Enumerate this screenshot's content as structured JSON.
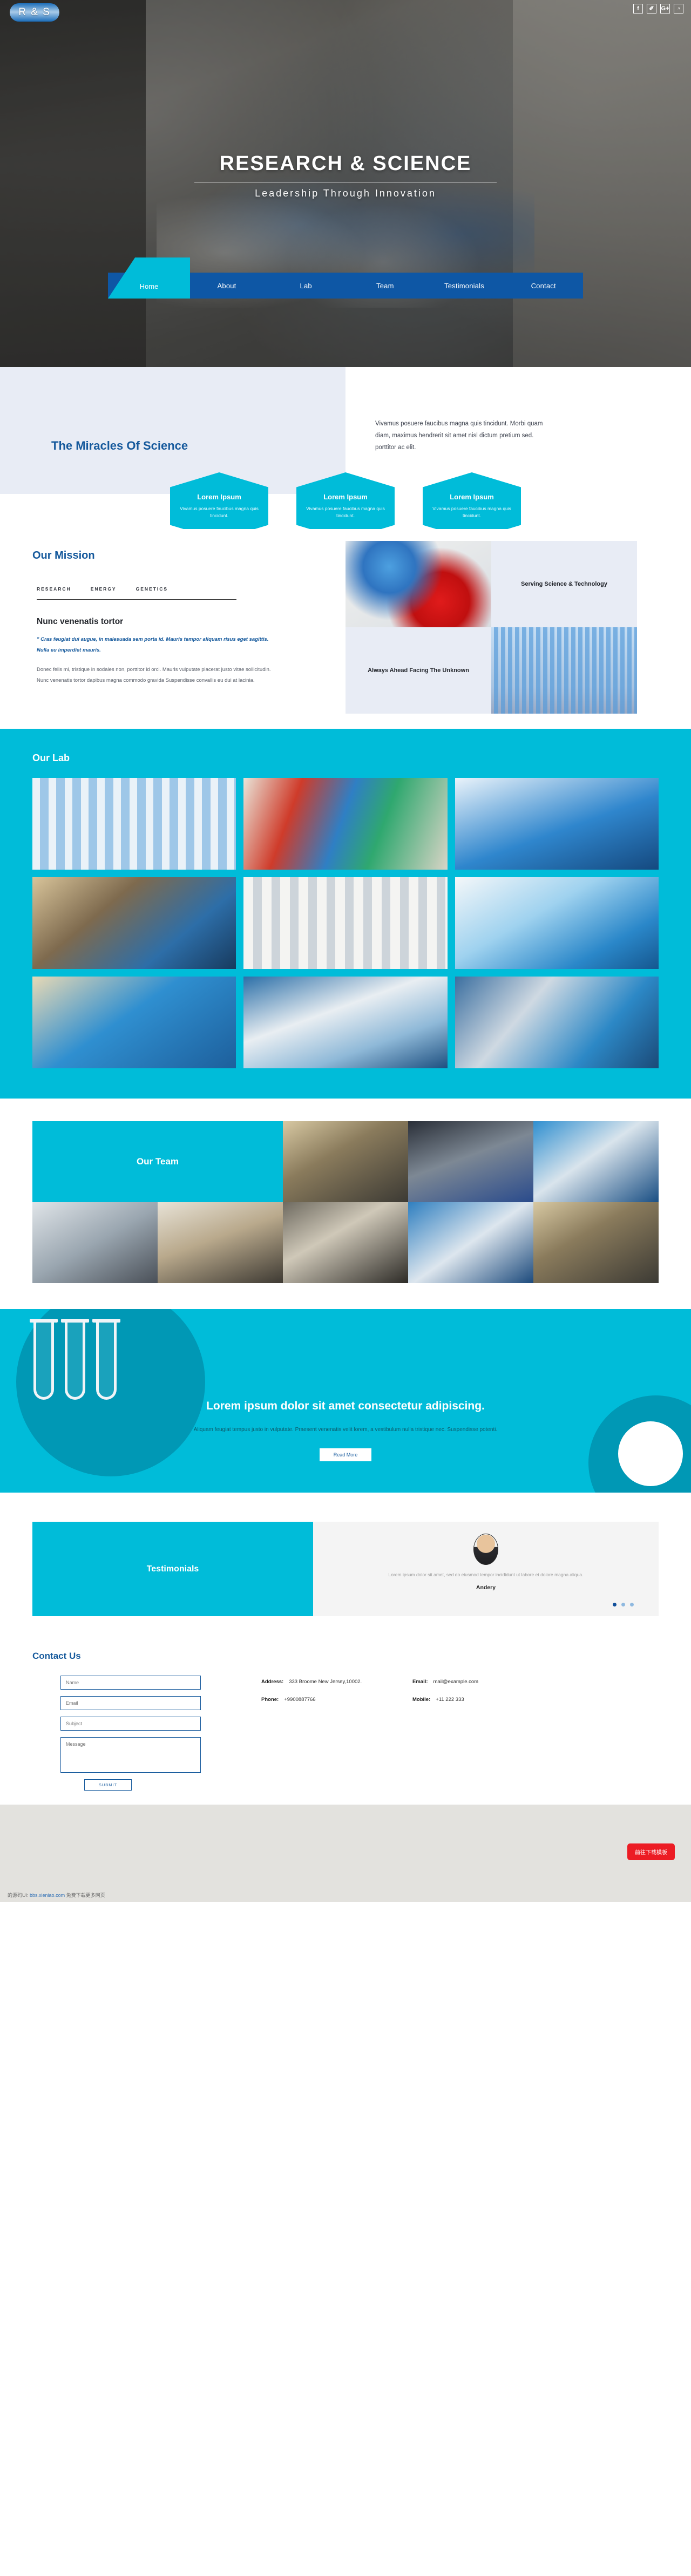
{
  "header": {
    "logo": "R & S",
    "social": [
      {
        "name": "facebook-icon",
        "glyph": "f"
      },
      {
        "name": "twitter-icon",
        "glyph": "✐"
      },
      {
        "name": "google-plus-icon",
        "glyph": "G+"
      },
      {
        "name": "rss-icon",
        "glyph": "◔"
      }
    ]
  },
  "hero": {
    "title": "RESEARCH & SCIENCE",
    "subtitle": "Leadership Through Innovation",
    "nav": [
      {
        "label": "Home",
        "active": true
      },
      {
        "label": "About",
        "active": false
      },
      {
        "label": "Lab",
        "active": false
      },
      {
        "label": "Team",
        "active": false
      },
      {
        "label": "Testimonials",
        "active": false
      },
      {
        "label": "Contact",
        "active": false
      }
    ]
  },
  "miracles": {
    "title": "The Miracles Of Science",
    "paragraph": "Vivamus posuere faucibus magna quis tincidunt. Morbi quam diam, maximus hendrerit sit amet nisl dictum pretium sed. porttitor ac elit.",
    "hexes": [
      {
        "title": "Lorem Ipsum",
        "text": "Vivamus posuere faucibus magna quis tincidunt."
      },
      {
        "title": "Lorem Ipsum",
        "text": "Vivamus posuere faucibus magna quis tincidunt."
      },
      {
        "title": "Lorem Ipsum",
        "text": "Vivamus posuere faucibus magna quis tincidunt."
      }
    ]
  },
  "mission": {
    "heading": "Our Mission",
    "tabs": [
      "RESEARCH",
      "ENERGY",
      "GENETICS"
    ],
    "subheading": "Nunc venenatis tortor",
    "quote": "\" Cras feugiat dui augue, in malesuada sem porta id. Mauris tempor aliquam risus eget sagittis. Nulla eu imperdiet mauris.",
    "body": "Donec felis mi, tristique in sodales non, porttitor id orci. Mauris vulputate placerat justo vitae sollicitudin. Nunc venenatis tortor dapibus magna commodo gravida Suspendisse convallis eu dui at lacinia.",
    "tile_top_text": "Serving Science & Technology",
    "tile_bottom_text": "Always Ahead Facing The Unknown"
  },
  "lab": {
    "heading": "Our Lab"
  },
  "team": {
    "heading": "Our Team"
  },
  "cta": {
    "heading": "Lorem ipsum dolor sit amet consectetur adipiscing.",
    "paragraph": "Aliquam feugiat tempus justo in vulputate. Praesent venenatis velit lorem, a vestibulum nulla tristique nec. Suspendisse potenti.",
    "button": "Read More"
  },
  "testimonials": {
    "heading": "Testimonials",
    "quote": "Lorem ipsum dolor sit amet, sed do eiusmod tempor incididunt ut labore et dolore magna aliqua.",
    "name": "Andery",
    "dots": 3,
    "active_dot": 0
  },
  "contact": {
    "heading": "Contact Us",
    "fields": [
      {
        "name": "name-field",
        "placeholder": "Name"
      },
      {
        "name": "email-field",
        "placeholder": "Email"
      },
      {
        "name": "subject-field",
        "placeholder": "Subject"
      }
    ],
    "message_placeholder": "Message",
    "submit": "SUBMIT",
    "info": {
      "address_label": "Address:",
      "address_value": "333 Broome New Jersey,10002.",
      "email_label": "Email:",
      "email_value": "mail@example.com",
      "phone_label": "Phone:",
      "phone_value": "+9900887766",
      "mobile_label": "Mobile:",
      "mobile_value": "+11 222 333"
    }
  },
  "footer": {
    "download_button": "前往下载模板",
    "credit_prefix": "的源码UI:",
    "credit_link": "bbs.xieniao.com",
    "credit_suffix": "免费下载更多网页"
  },
  "colors": {
    "cyan": "#00bcd9",
    "blue": "#0e57a5",
    "deep_blue": "#15599c",
    "pale": "#e8ecf5",
    "red": "#ec1c24"
  }
}
